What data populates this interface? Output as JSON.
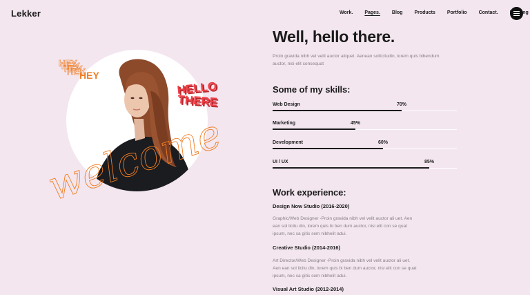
{
  "header": {
    "logo": "Lekker",
    "nav": [
      "Work.",
      "Pages.",
      "Blog",
      "Products",
      "Portfolio",
      "Contact.",
      "Landing"
    ],
    "active_nav": "Pages."
  },
  "hero": {
    "sticker_hey_stack": "HEY",
    "sticker_hey": "HEY",
    "sticker_hello": "HELLO",
    "sticker_there": "THERE",
    "script_word": "welcome"
  },
  "intro": {
    "title": "Well, hello there.",
    "text": "Proin gravida nibh vel velit auctor aliquet. Aenean sollicitudin, lorem quis bibendum auctor, nisi elit consequat"
  },
  "skills": {
    "heading": "Some of my skills:",
    "items": [
      {
        "label": "Web Design",
        "pct_label": "70%",
        "value": 0.7
      },
      {
        "label": "Marketing",
        "pct_label": "45%",
        "value": 0.45
      },
      {
        "label": "Development",
        "pct_label": "60%",
        "value": 0.6
      },
      {
        "label": "UI / UX",
        "pct_label": "85%",
        "value": 0.85
      }
    ]
  },
  "experience": {
    "heading": "Work experience:",
    "jobs": [
      {
        "title": "Design Now Studio (2016-2020)",
        "desc": "Graphic/Web Designer -Proin gravida nibh vel velit auctor ali uet. Aen ean sol licitu din, lorem quis bi ben dum auctor, nisi elit con se quat ipsum, nec sa gitis sem nibhelit adui."
      },
      {
        "title": "Creative Studio (2014-2016)",
        "desc": "Art Director/Web Designer -Proin gravida nibh vel velit auctor ali uet. Aen ean sol licitu din, lorem quis bi ben dum auctor, nisi elit con se quat ipsum, nec sa gitis sem nibhelit adui."
      },
      {
        "title": "Visual Art Studio (2012-2014)",
        "desc": ""
      }
    ]
  },
  "colors": {
    "background": "#f3e6ef",
    "accent_orange": "#f07d22",
    "accent_red": "#ef3f47",
    "text": "#1b1b1b"
  }
}
